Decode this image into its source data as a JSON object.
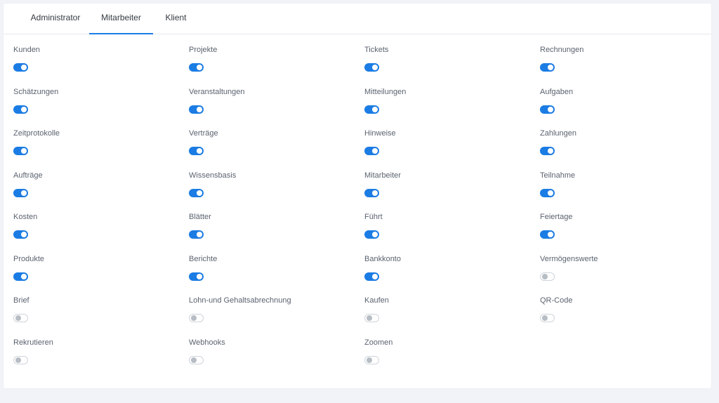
{
  "tabs": [
    {
      "label": "Administrator",
      "active": false
    },
    {
      "label": "Mitarbeiter",
      "active": true
    },
    {
      "label": "Klient",
      "active": false
    }
  ],
  "colors": {
    "accent": "#1b7ce4",
    "toggle_off_knob": "#b7bdc4",
    "label": "#5b6370",
    "background": "#f1f3f8"
  },
  "permissions": [
    {
      "label": "Kunden",
      "enabled": true
    },
    {
      "label": "Projekte",
      "enabled": true
    },
    {
      "label": "Tickets",
      "enabled": true
    },
    {
      "label": "Rechnungen",
      "enabled": true
    },
    {
      "label": "Schätzungen",
      "enabled": true
    },
    {
      "label": "Veranstaltungen",
      "enabled": true
    },
    {
      "label": "Mitteilungen",
      "enabled": true
    },
    {
      "label": "Aufgaben",
      "enabled": true
    },
    {
      "label": "Zeitprotokolle",
      "enabled": true
    },
    {
      "label": "Verträge",
      "enabled": true
    },
    {
      "label": "Hinweise",
      "enabled": true
    },
    {
      "label": "Zahlungen",
      "enabled": true
    },
    {
      "label": "Aufträge",
      "enabled": true
    },
    {
      "label": "Wissensbasis",
      "enabled": true
    },
    {
      "label": "Mitarbeiter",
      "enabled": true
    },
    {
      "label": "Teilnahme",
      "enabled": true
    },
    {
      "label": "Kosten",
      "enabled": true
    },
    {
      "label": "Blätter",
      "enabled": true
    },
    {
      "label": "Führt",
      "enabled": true
    },
    {
      "label": "Feiertage",
      "enabled": true
    },
    {
      "label": "Produkte",
      "enabled": true
    },
    {
      "label": "Berichte",
      "enabled": true
    },
    {
      "label": "Bankkonto",
      "enabled": true
    },
    {
      "label": "Vermögenswerte",
      "enabled": false
    },
    {
      "label": "Brief",
      "enabled": false
    },
    {
      "label": "Lohn-und Gehaltsabrechnung",
      "enabled": false
    },
    {
      "label": "Kaufen",
      "enabled": false
    },
    {
      "label": "QR-Code",
      "enabled": false
    },
    {
      "label": "Rekrutieren",
      "enabled": false
    },
    {
      "label": "Webhooks",
      "enabled": false
    },
    {
      "label": "Zoomen",
      "enabled": false
    }
  ]
}
